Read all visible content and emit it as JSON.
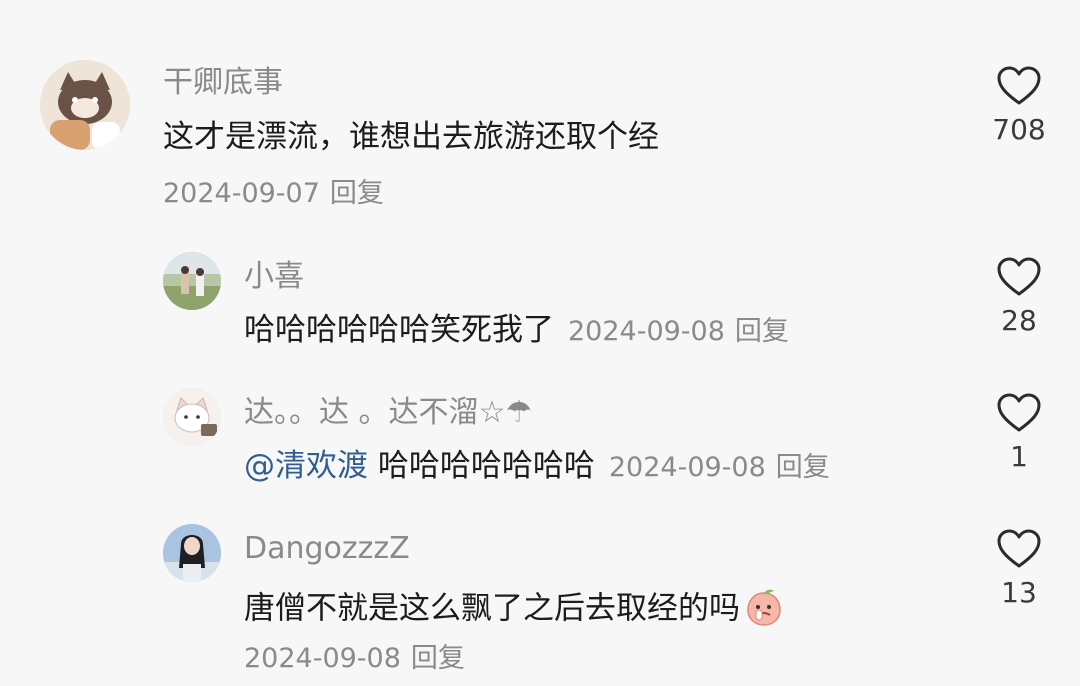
{
  "comments": [
    {
      "username": "干卿底事",
      "text": "这才是漂流，谁想出去旅游还取个经",
      "date": "2024-09-07",
      "reply_label": "回复",
      "likes": "708"
    },
    {
      "username": "小喜",
      "text": "哈哈哈哈哈哈笑死我了",
      "date": "2024-09-08",
      "reply_label": "回复",
      "likes": "28"
    },
    {
      "username": "达。。达 。达不溜☆☂",
      "mention": "@清欢渡",
      "text": "哈哈哈哈哈哈哈",
      "date": "2024-09-08",
      "reply_label": "回复",
      "likes": "1"
    },
    {
      "username": "DangozzzZ",
      "text": "唐僧不就是这么飘了之后去取经的吗",
      "emoji": "peach-face-emoji",
      "date": "2024-09-08",
      "reply_label": "回复",
      "likes": "13"
    }
  ],
  "icons": {
    "like": "heart-outline-icon"
  },
  "colors": {
    "background": "#f7f7f8",
    "text": "#1c1c1c",
    "meta": "#8a8a8a",
    "mention": "#2f5e8f"
  }
}
